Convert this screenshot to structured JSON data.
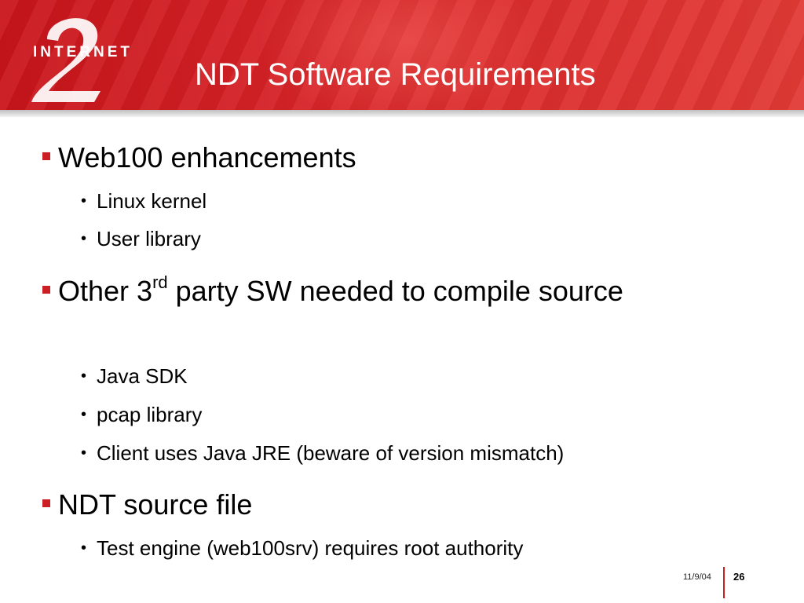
{
  "logo": {
    "text": "INTERNET",
    "numeral": "2"
  },
  "title": "NDT Software Requirements",
  "bullets": [
    {
      "text": "Web100 enhancements",
      "sub": [
        "Linux kernel",
        "User library"
      ]
    },
    {
      "text_before": "Other 3",
      "superscript": "rd",
      "text_after": " party SW needed to compile source",
      "sub": [
        "Java SDK",
        "pcap library",
        "Client uses Java JRE (beware of version mismatch)"
      ]
    },
    {
      "text": "NDT source file",
      "sub": [
        "Test engine (web100srv) requires root authority"
      ]
    }
  ],
  "footer": {
    "date": "11/9/04",
    "page": "26"
  },
  "colors": {
    "header_red": "#d9262a",
    "bullet_red": "#cc1f24"
  }
}
